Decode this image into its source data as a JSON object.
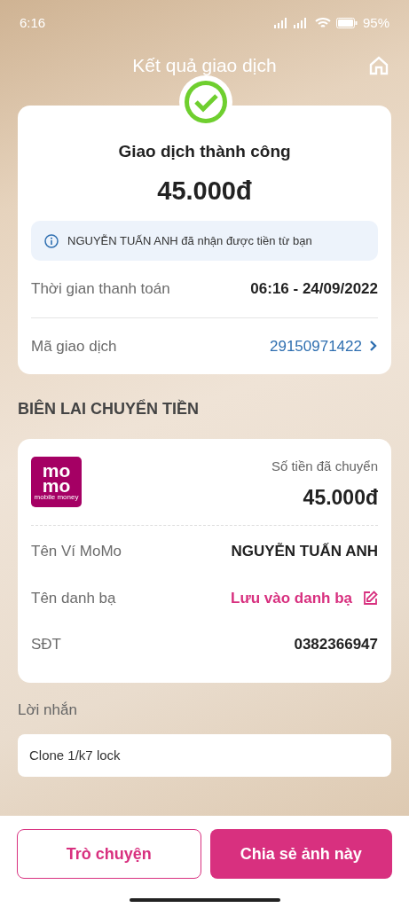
{
  "status_bar": {
    "time": "6:16",
    "battery": "95%"
  },
  "header": {
    "title": "Kết quả giao dịch"
  },
  "result": {
    "status": "Giao dịch thành công",
    "amount": "45.000đ",
    "notice": "NGUYỄN TUẤN ANH đã nhận được tiền từ bạn",
    "rows": [
      {
        "label": "Thời gian thanh toán",
        "value": "06:16 - 24/09/2022",
        "kind": "plain"
      },
      {
        "label": "Mã giao dịch",
        "value": "29150971422",
        "kind": "link"
      }
    ]
  },
  "receipt": {
    "title": "BIÊN LAI CHUYỂN TIỀN",
    "logo": {
      "wordmark": "mo mo",
      "tagline": "mobile money"
    },
    "amount_label": "Số tiền đã chuyển",
    "amount": "45.000đ",
    "rows": [
      {
        "label": "Tên Ví MoMo",
        "value": "NGUYỄN TUẤN ANH",
        "kind": "plain"
      },
      {
        "label": "Tên danh bạ",
        "value": "Lưu vào danh bạ",
        "kind": "action"
      },
      {
        "label": "SĐT",
        "value": "0382366947",
        "kind": "plain"
      }
    ]
  },
  "message": {
    "label": "Lời nhắn",
    "value": "Clone 1/k7 lock"
  },
  "buttons": [
    {
      "label": "Trò chuyện",
      "kind": "outline"
    },
    {
      "label": "Chia sẻ ảnh này",
      "kind": "filled"
    }
  ]
}
